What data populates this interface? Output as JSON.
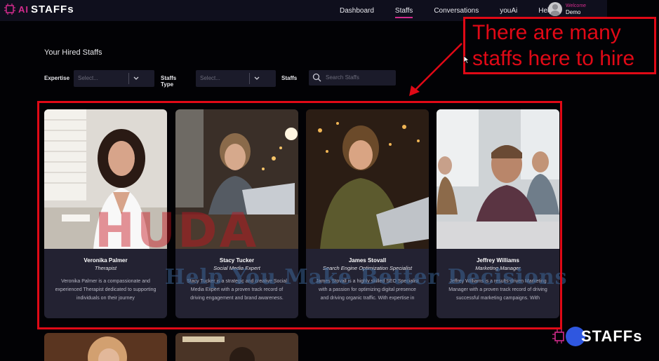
{
  "brand": {
    "logo_text": "STAFFs",
    "logo_prefix": "AI"
  },
  "nav": {
    "items": [
      {
        "label": "Dashboard",
        "active": false
      },
      {
        "label": "Staffs",
        "active": true
      },
      {
        "label": "Conversations",
        "active": false
      },
      {
        "label": "youAi",
        "active": false
      },
      {
        "label": "Help",
        "active": false
      }
    ],
    "user": {
      "welcome": "Welcome",
      "name": "Demo"
    }
  },
  "section": {
    "title": "Your Hired Staffs"
  },
  "filters": {
    "expertise_label": "Expertise",
    "expertise_placeholder": "Select...",
    "type_label": "Staffs Type",
    "type_placeholder": "Select...",
    "staffs_label": "Staffs",
    "search_placeholder": "Search Staffs"
  },
  "annotation": {
    "text": "There are many staffs here to hire",
    "color": "#e00916"
  },
  "staffs": [
    {
      "name": "Veronika Palmer",
      "role": "Therapist",
      "description": "Veronika Palmer is a compassionate and experienced Therapist dedicated to supporting individuals on their journey"
    },
    {
      "name": "Stacy Tucker",
      "role": "Social Media Expert",
      "description": "Stacy Tucker is a strategic and creative Social Media Expert with a proven track record of driving engagement and brand awareness."
    },
    {
      "name": "James Stovall",
      "role": "Search Engine Optimization Specialist",
      "description": "James Stovall is a highly skilled SEO Specialist with a passion for optimizing digital presence and driving organic traffic. With expertise in"
    },
    {
      "name": "Jeffrey Williams",
      "role": "Marketing Manager",
      "description": "Jeffrey Williams is a results-driven Marketing Manager with a proven track record of driving successful marketing campaigns. With"
    }
  ],
  "watermark": {
    "line1": "HUDA",
    "line2": "Help You Make Better Decisions"
  },
  "corner_logo": {
    "text": "STAFFs"
  },
  "colors": {
    "accent": "#d22b8c",
    "panel": "#232232",
    "nav_bg": "#0f0f1d"
  }
}
